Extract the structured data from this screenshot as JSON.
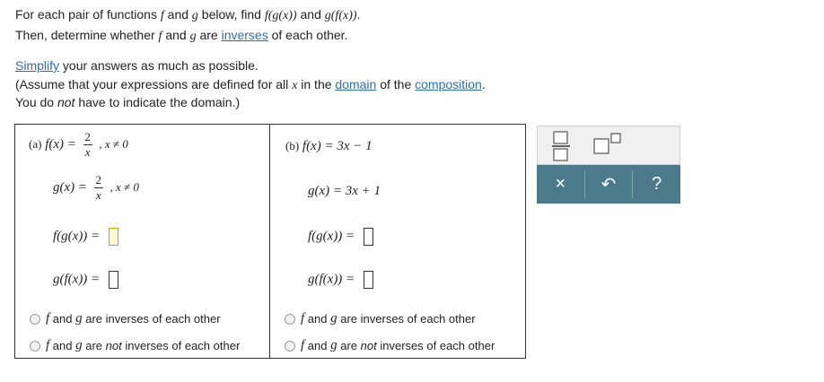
{
  "instructions": {
    "line1_a": "For each pair of functions",
    "f": "f",
    "and": "and",
    "g": "g",
    "line1_b": "below, find",
    "fgx": "f(g(x))",
    "gfx": "g(f(x))",
    "period": ".",
    "line2_a": "Then, determine whether",
    "line2_b": "are",
    "inverses_link": "inverses",
    "line2_c": "of each other.",
    "simplify_link": "Simplify",
    "line3": "your answers as much as possible.",
    "line4_a": "(Assume that your expressions are defined for all",
    "x": "x",
    "line4_b": "in the",
    "domain_link": "domain",
    "line4_c": "of the",
    "composition_link": "composition",
    "line5_a": "You do",
    "not": "not",
    "line5_b": "have to indicate the domain.)"
  },
  "part_a": {
    "label": "(a)",
    "f_def": "f(x) =",
    "f_num": "2",
    "f_den": "x",
    "f_cond": ", x ≠ 0",
    "g_def": "g(x) =",
    "g_num": "2",
    "g_den": "x",
    "g_cond": ", x ≠ 0",
    "fg_label": "f(g(x)) =",
    "gf_label": "g(f(x)) ="
  },
  "part_b": {
    "label": "(b)",
    "f_def": "f(x) = 3x − 1",
    "g_def": "g(x) = 3x + 1",
    "fg_label": "f(g(x)) =",
    "gf_label": "g(f(x)) ="
  },
  "options": {
    "f": "f",
    "g": "g",
    "and": "and",
    "inverse_tail": "are inverses of each other",
    "are": "are",
    "not": "not",
    "not_tail": "inverses of each other"
  },
  "toolbar": {
    "clear_glyph": "×",
    "undo_glyph": "↶",
    "help_glyph": "?"
  },
  "colors": {
    "link": "#2f6ea3",
    "toolbar_bg": "#4c7a8a",
    "toolbar_top_bg": "#f0f0f0",
    "active_box": "#c8a400"
  },
  "icons": [
    "fraction-icon",
    "superscript-icon",
    "clear-icon",
    "undo-icon",
    "help-icon"
  ]
}
